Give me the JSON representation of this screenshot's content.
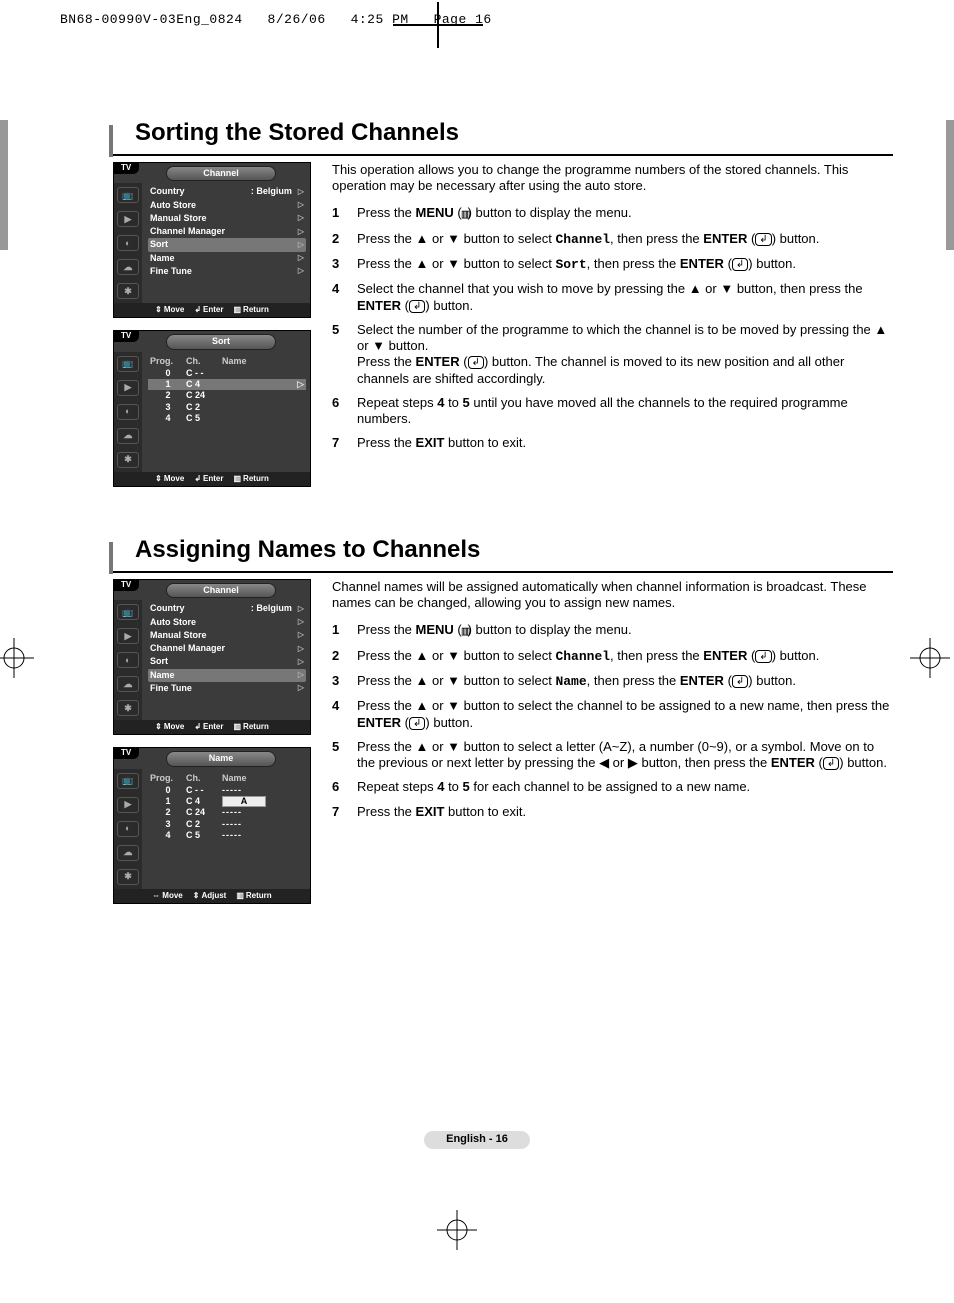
{
  "header": {
    "filename": "BN68-00990V-03Eng_0824",
    "date": "8/26/06",
    "time": "4:25 PM",
    "pagemark": "Page 16"
  },
  "footer": {
    "page_label": "English - 16"
  },
  "osd": {
    "tv_label": "TV",
    "footer": {
      "move": "Move",
      "enter": "Enter",
      "return": "Return",
      "adjust": "Adjust"
    }
  },
  "osd1a": {
    "title": "Channel",
    "items": [
      {
        "label": "Country",
        "value": ": Belgium"
      },
      {
        "label": "Auto Store"
      },
      {
        "label": "Manual Store"
      },
      {
        "label": "Channel Manager"
      },
      {
        "label": "Sort"
      },
      {
        "label": "Name"
      },
      {
        "label": "Fine Tune"
      }
    ]
  },
  "osd1b": {
    "title": "Sort",
    "headers": [
      "Prog.",
      "Ch.",
      "Name"
    ],
    "rows": [
      {
        "prog": "0",
        "ch": "C - -"
      },
      {
        "prog": "1",
        "ch": "C 4"
      },
      {
        "prog": "2",
        "ch": "C 24"
      },
      {
        "prog": "3",
        "ch": "C 2"
      },
      {
        "prog": "4",
        "ch": "C 5"
      }
    ]
  },
  "osd2a": {
    "title": "Channel",
    "items": [
      {
        "label": "Country",
        "value": ": Belgium"
      },
      {
        "label": "Auto Store"
      },
      {
        "label": "Manual Store"
      },
      {
        "label": "Channel Manager"
      },
      {
        "label": "Sort"
      },
      {
        "label": "Name"
      },
      {
        "label": "Fine Tune"
      }
    ]
  },
  "osd2b": {
    "title": "Name",
    "headers": [
      "Prog.",
      "Ch.",
      "Name"
    ],
    "rows": [
      {
        "prog": "0",
        "ch": "C - -",
        "name": "-----"
      },
      {
        "prog": "1",
        "ch": "C 4",
        "name": "A"
      },
      {
        "prog": "2",
        "ch": "C 24",
        "name": "-----"
      },
      {
        "prog": "3",
        "ch": "C 2",
        "name": "-----"
      },
      {
        "prog": "4",
        "ch": "C 5",
        "name": "-----"
      }
    ]
  },
  "section1": {
    "title": "Sorting the Stored Channels",
    "intro": "This operation allows you to change the programme numbers of the stored channels. This operation may be necessary after using the auto store.",
    "steps": [
      {
        "num": "1"
      },
      {
        "num": "2",
        "kw": "Channel"
      },
      {
        "num": "3",
        "kw": "Sort"
      },
      {
        "num": "4"
      },
      {
        "num": "5"
      },
      {
        "num": "6"
      },
      {
        "num": "7"
      }
    ]
  },
  "section2": {
    "title": "Assigning Names to Channels",
    "intro": "Channel names will be assigned automatically when channel information is broadcast. These names can be changed, allowing you to assign new names.",
    "steps": [
      {
        "num": "1"
      },
      {
        "num": "2",
        "kw": "Channel"
      },
      {
        "num": "3",
        "kw": "Name"
      },
      {
        "num": "4"
      },
      {
        "num": "5"
      },
      {
        "num": "6"
      },
      {
        "num": "7"
      }
    ]
  }
}
